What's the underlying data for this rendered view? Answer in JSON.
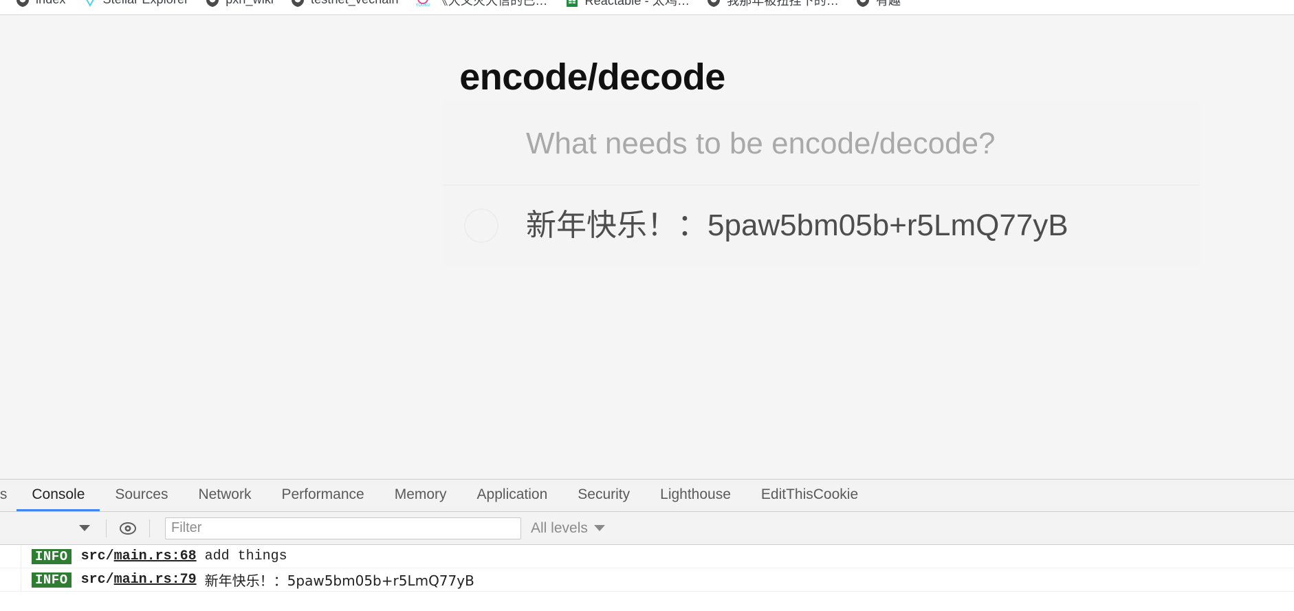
{
  "browser": {
    "bookmarks": [
      {
        "label": "index",
        "icon": "shield-icon"
      },
      {
        "label": "Stellar Explorer",
        "icon": "stellar-icon"
      },
      {
        "label": "pxh_wiki",
        "icon": "shield-icon"
      },
      {
        "label": "testnet_vechain",
        "icon": "shield-icon"
      },
      {
        "label": "《大义灭大信的已…",
        "icon": "youku-icon"
      },
      {
        "label": "Reactable - 太鸡…",
        "icon": "sheets-icon"
      },
      {
        "label": "我那年被扭捏下的…",
        "icon": "shield-icon"
      },
      {
        "label": "有趣",
        "icon": "shield-icon"
      }
    ]
  },
  "app": {
    "title": "encode/decode",
    "input": {
      "placeholder": "What needs to be encode/decode?",
      "value": ""
    },
    "items": [
      {
        "label": "新年快乐！：5paw5bm05b+r5LmQ77yB",
        "completed": false
      }
    ]
  },
  "devtools": {
    "tabs": [
      {
        "label": "ts",
        "active": false,
        "partial": true
      },
      {
        "label": "Console",
        "active": true,
        "partial": false
      },
      {
        "label": "Sources",
        "active": false,
        "partial": false
      },
      {
        "label": "Network",
        "active": false,
        "partial": false
      },
      {
        "label": "Performance",
        "active": false,
        "partial": false
      },
      {
        "label": "Memory",
        "active": false,
        "partial": false
      },
      {
        "label": "Application",
        "active": false,
        "partial": false
      },
      {
        "label": "Security",
        "active": false,
        "partial": false
      },
      {
        "label": "Lighthouse",
        "active": false,
        "partial": false
      },
      {
        "label": "EditThisCookie",
        "active": false,
        "partial": false
      }
    ],
    "toolbar": {
      "filter_placeholder": "Filter",
      "filter_value": "",
      "levels_label": "All levels"
    },
    "console_rows": [
      {
        "level": "INFO",
        "source_prefix": "src/",
        "source_link": "main.rs:68",
        "message": "add things",
        "cjk": false
      },
      {
        "level": "INFO",
        "source_prefix": "src/",
        "source_link": "main.rs:79",
        "message": "新年快乐！：5paw5bm05b+r5LmQ77yB",
        "cjk": true
      }
    ]
  },
  "colors": {
    "accent": "#4285f4",
    "info_badge_bg": "#2e7d32",
    "page_bg": "#f5f5f5",
    "card_bg": "#f4f4f4",
    "toggle_border": "#ededed"
  }
}
